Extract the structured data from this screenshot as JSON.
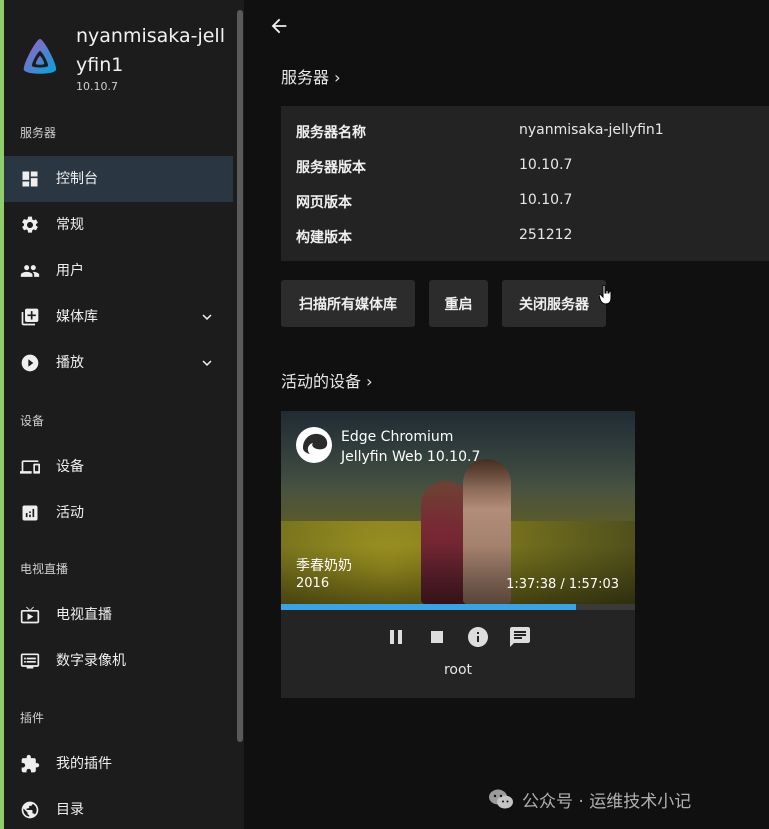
{
  "sidebar": {
    "server_name": "nyanmisaka-jellyfin1",
    "server_version": "10.10.7",
    "sections": [
      {
        "title": "服务器"
      },
      {
        "title": "设备"
      },
      {
        "title": "电视直播"
      },
      {
        "title": "插件"
      }
    ],
    "items": [
      {
        "label": "控制台",
        "icon": "dashboard-icon"
      },
      {
        "label": "常规",
        "icon": "gear-icon"
      },
      {
        "label": "用户",
        "icon": "people-icon"
      },
      {
        "label": "媒体库",
        "icon": "library-add-icon"
      },
      {
        "label": "播放",
        "icon": "play-circle-icon"
      },
      {
        "label": "设备",
        "icon": "devices-icon"
      },
      {
        "label": "活动",
        "icon": "analytics-icon"
      },
      {
        "label": "电视直播",
        "icon": "live-tv-icon"
      },
      {
        "label": "数字录像机",
        "icon": "dvr-icon"
      },
      {
        "label": "我的插件",
        "icon": "puzzle-icon"
      },
      {
        "label": "目录",
        "icon": "globe-icon"
      }
    ]
  },
  "main": {
    "server_section": "服务器 ›",
    "info": [
      {
        "key": "服务器名称",
        "value": "nyanmisaka-jellyfin1"
      },
      {
        "key": "服务器版本",
        "value": "10.10.7"
      },
      {
        "key": "网页版本",
        "value": "10.10.7"
      },
      {
        "key": "构建版本",
        "value": "251212"
      }
    ],
    "buttons": {
      "scan": "扫描所有媒体库",
      "restart": "重启",
      "shutdown": "关闭服务器"
    },
    "devices_section": "活动的设备 ›",
    "device": {
      "client": "Edge Chromium",
      "client_version": "Jellyfin Web 10.10.7",
      "media_title": "季春奶奶",
      "media_year": "2016",
      "time": "1:37:38 / 1:57:03",
      "progress": 0.834,
      "user": "root"
    }
  },
  "watermark": "公众号 · 运维技术小记",
  "colors": {
    "accent": "#3aa3e3",
    "active_nav": "#2a3742",
    "card": "#232323",
    "sidebar": "#1c1c1c"
  }
}
